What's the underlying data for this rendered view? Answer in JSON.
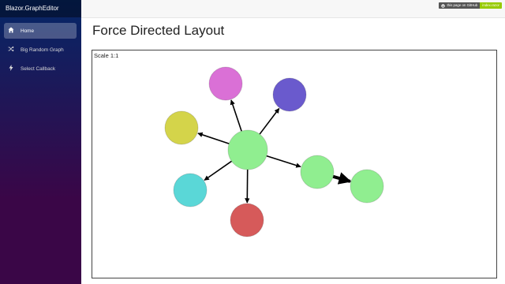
{
  "app": {
    "brand": "Blazor.GraphEditor"
  },
  "nav": [
    {
      "label": "Home",
      "icon": "home-icon",
      "active": true
    },
    {
      "label": "Big Random Graph",
      "icon": "shuffle-icon",
      "active": false
    },
    {
      "label": "Select Callback",
      "icon": "lightning-icon",
      "active": false
    }
  ],
  "github_badge": {
    "left": "this page on GitHub",
    "right": "index.razor"
  },
  "page": {
    "title": "Force Directed Layout"
  },
  "graph": {
    "scale_label": "Scale 1:1",
    "nodes": [
      {
        "id": "center",
        "color": "#90ee90"
      },
      {
        "id": "magenta",
        "color": "#da70d6"
      },
      {
        "id": "blue",
        "color": "#6a5acd"
      },
      {
        "id": "yellow",
        "color": "#d4d44a"
      },
      {
        "id": "cyan",
        "color": "#5ad7d7"
      },
      {
        "id": "red",
        "color": "#d65a5a"
      },
      {
        "id": "green-mid",
        "color": "#90ee90"
      },
      {
        "id": "green-right",
        "color": "#90ee90"
      }
    ],
    "edges": [
      {
        "from": "center",
        "to": "magenta"
      },
      {
        "from": "center",
        "to": "blue"
      },
      {
        "from": "center",
        "to": "yellow"
      },
      {
        "from": "center",
        "to": "cyan"
      },
      {
        "from": "center",
        "to": "red"
      },
      {
        "from": "center",
        "to": "green-mid"
      },
      {
        "from": "green-mid",
        "to": "green-right",
        "bold": true
      }
    ]
  }
}
